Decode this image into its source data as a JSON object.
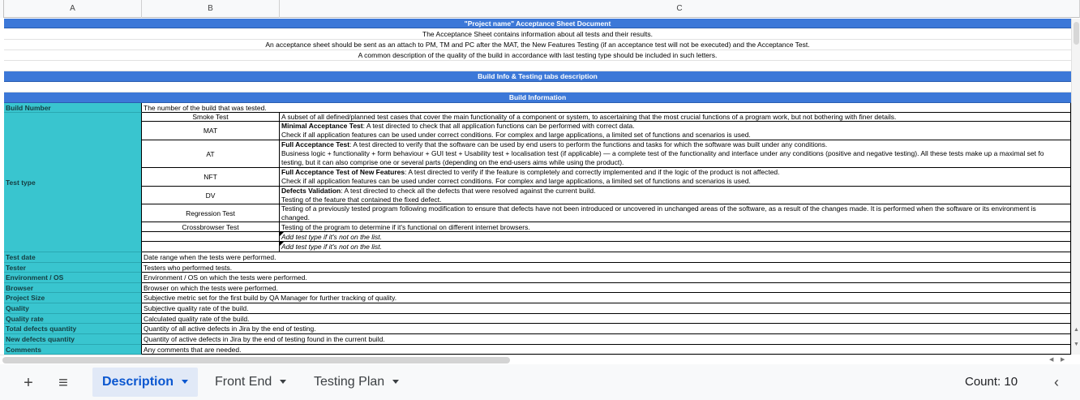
{
  "columns": [
    "A",
    "B",
    "C"
  ],
  "title": "\"Project name\" Acceptance Sheet Document",
  "intro_lines": [
    "The Acceptance Sheet contains information about all tests and their results.",
    "An acceptance sheet should be sent as an attach to PM, TM and PC after the MAT, the New Features Testing (if an acceptance test will not be executed) and the Acceptance Test.",
    "A common description of the quality of the build in accordance with last testing type should be included in such letters."
  ],
  "section1": "Build Info & Testing tabs description",
  "section2": "Build Information",
  "build_number": {
    "label": "Build Number",
    "desc": "The number of the build that was tested."
  },
  "test_type_label": "Test type",
  "test_types": [
    {
      "name": "Smoke Test",
      "bold": "",
      "lines": [
        "A subset of all defined/planned test cases that cover the main functionality of a component or system, to ascertaining that the most crucial functions of a program work, but not bothering with finer details."
      ]
    },
    {
      "name": "MAT",
      "bold": "Minimal Acceptance Test",
      "lines": [
        ": A test directed to check that all application functions can be performed with correct data.",
        "Check if all application features can be used under correct conditions. For complex and large applications, a limited set of functions and scenarios is used."
      ]
    },
    {
      "name": "AT",
      "bold": "Full Acceptance Test",
      "lines": [
        ": A test directed to verify that the software can be used by end users to perform the functions and tasks for which the software was built under any conditions.",
        "Business logic + functionality + form behaviour + GUI test + Usability test + localisation test (if applicable) — a complete test of the functionality and interface under any conditions (positive and negative testing). All these tests make up a maximal set fo",
        "testing, but it can also comprise one or several parts (depending on the end-users aims while using the product)."
      ]
    },
    {
      "name": "NFT",
      "bold": "Full Acceptance Test of New Features",
      "lines": [
        ": A test directed to verify if the feature is completely and correctly implemented and if the logic of the product is not affected.",
        "Check if all application features can be used under correct conditions. For complex and large applications, a limited set of functions and scenarios is used."
      ]
    },
    {
      "name": "DV",
      "bold": "Defects Validation",
      "lines": [
        ": A test directed to check all the defects that were resolved against the current build.",
        "Testing of the feature that contained the fixed defect."
      ]
    },
    {
      "name": "Regression Test",
      "bold": "",
      "lines": [
        "Testing of a previously tested program following modification to ensure that defects have not been introduced or uncovered in unchanged areas of the software, as a result of the changes made. It is performed when the software or its environment is",
        "changed."
      ]
    },
    {
      "name": "Crossbrowser Test",
      "bold": "",
      "lines": [
        "Testing of the program to determine if it's functional on different internet browsers."
      ]
    }
  ],
  "add_test_type": [
    "Add test type if it's not on the list.",
    "Add test type if it's not on the list."
  ],
  "fields": [
    {
      "label": "Test date",
      "desc": "Date range when the tests were performed."
    },
    {
      "label": "Tester",
      "desc": "Testers who performed tests."
    },
    {
      "label": "Environment / OS",
      "desc": "Environment / OS on which the tests were performed."
    },
    {
      "label": "Browser",
      "desc": "Browser on which the tests were performed."
    },
    {
      "label": "Project Size",
      "desc": "Subjective metric set for the first build by QA Manager for further tracking of quality."
    },
    {
      "label": "Quality",
      "desc": "Subjective quality rate of the build."
    },
    {
      "label": "Quality rate",
      "desc": "Calculated quality rate of the build."
    },
    {
      "label": "Total defects quantity",
      "desc": "Quantity of all active defects in Jira by the end of testing."
    },
    {
      "label": "New defects quantity",
      "desc": "Quantity of active defects in Jira by the end of testing found in the current build."
    },
    {
      "label": "Comments",
      "desc": "Any comments that are needed."
    }
  ],
  "sheet_bar": {
    "add_icon": "+",
    "menu_icon": "≡",
    "tabs": [
      "Description",
      "Front End",
      "Testing Plan"
    ],
    "active_tab": 0,
    "count": "Count: 10",
    "collapse_icon": "‹"
  },
  "colors": {
    "header_blue": "#3c78d8",
    "label_teal": "#39c5cf",
    "active_tab": "#0b57d0"
  }
}
